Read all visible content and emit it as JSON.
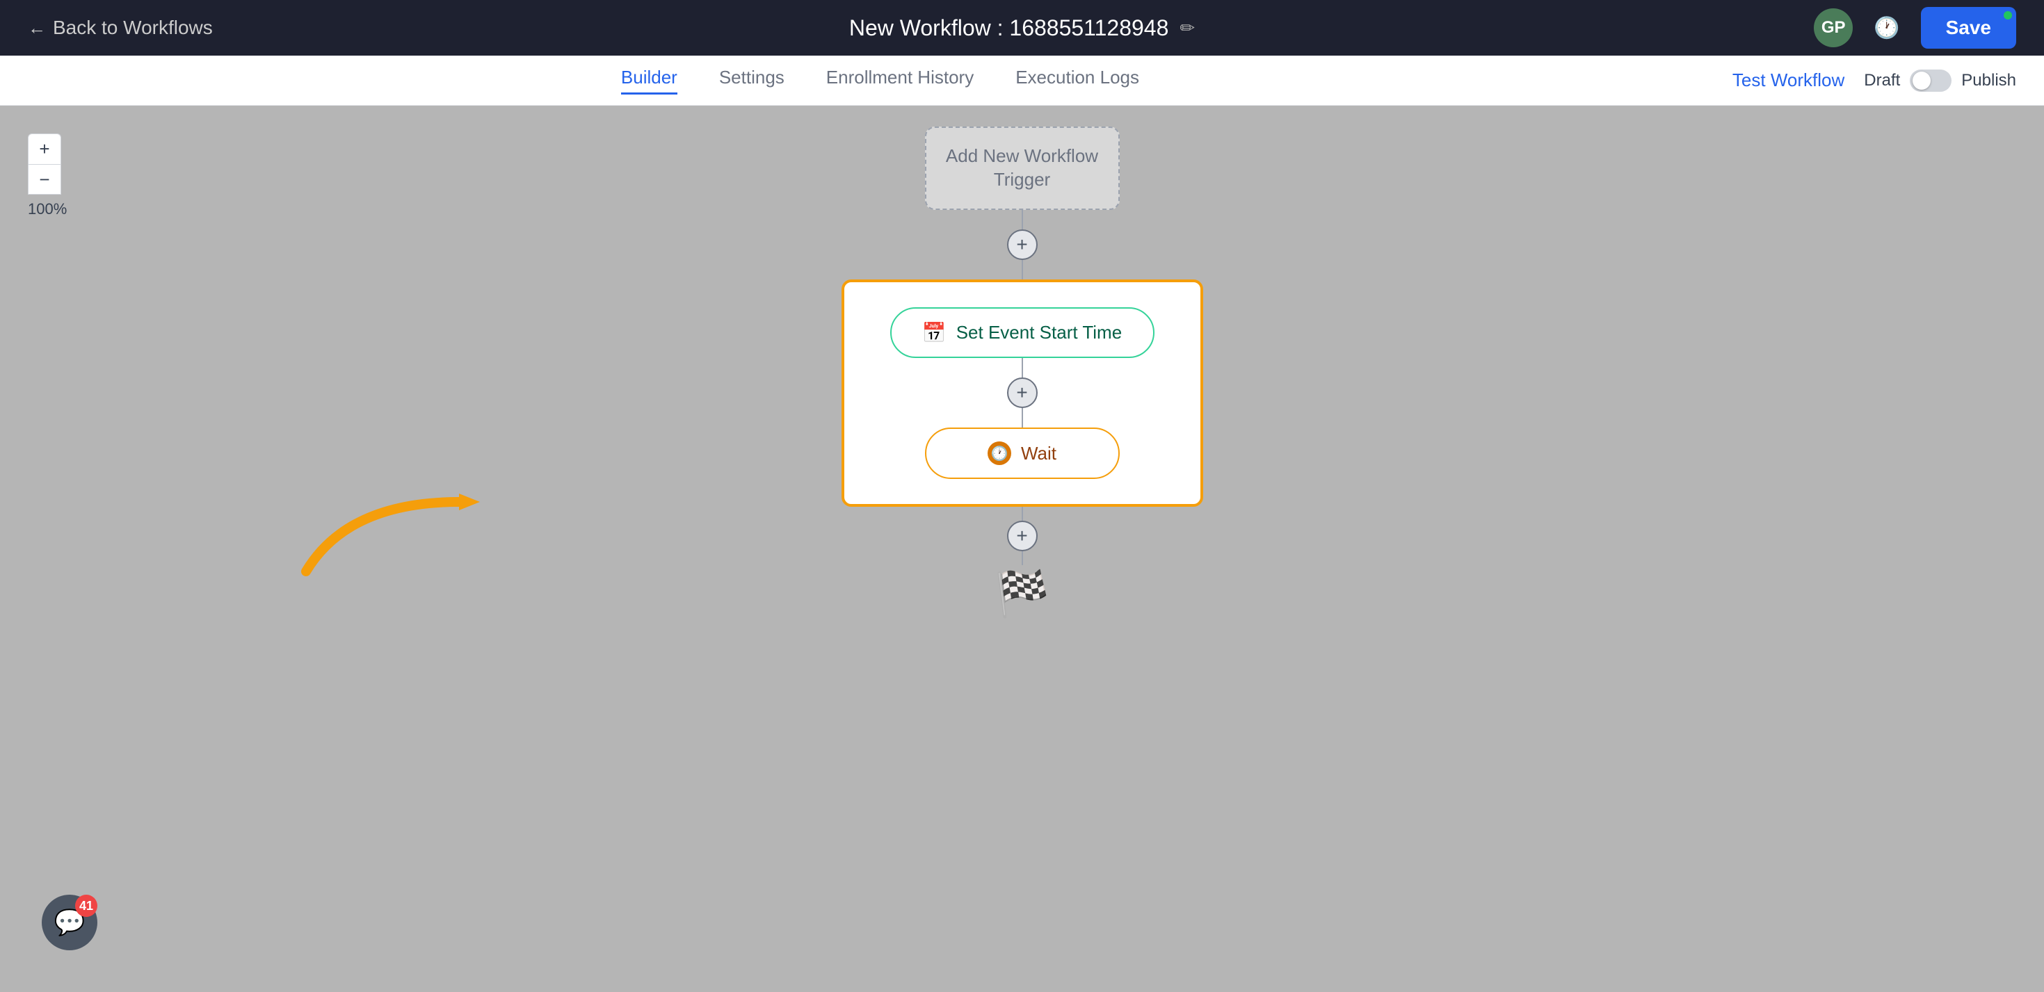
{
  "topBar": {
    "backLabel": "Back to Workflows",
    "workflowTitle": "New Workflow : 1688551128948",
    "editIcon": "✏",
    "avatarInitials": "GP",
    "saveLabel": "Save"
  },
  "subNav": {
    "tabs": [
      {
        "id": "builder",
        "label": "Builder",
        "active": true
      },
      {
        "id": "settings",
        "label": "Settings",
        "active": false
      },
      {
        "id": "enrollment",
        "label": "Enrollment History",
        "active": false
      },
      {
        "id": "execution",
        "label": "Execution Logs",
        "active": false
      }
    ],
    "testWorkflowLabel": "Test Workflow",
    "draftLabel": "Draft",
    "publishLabel": "Publish"
  },
  "canvas": {
    "zoomLevel": "100%",
    "zoomInLabel": "+",
    "zoomOutLabel": "−"
  },
  "workflow": {
    "triggerLabel": "Add New Workflow Trigger",
    "setEventLabel": "Set Event Start Time",
    "waitLabel": "Wait"
  },
  "chat": {
    "badgeCount": "41"
  }
}
